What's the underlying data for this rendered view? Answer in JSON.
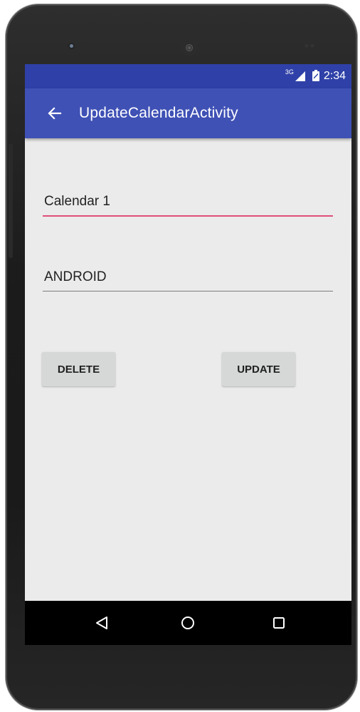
{
  "status_bar": {
    "network": "3G",
    "time": "2:34"
  },
  "toolbar": {
    "title": "UpdateCalendarActivity",
    "back_icon": "arrow-left-icon"
  },
  "form": {
    "calendar_name_value": "Calendar 1",
    "account_type_value": "ANDROID"
  },
  "buttons": {
    "delete_label": "DELETE",
    "update_label": "UPDATE"
  },
  "nav_bar": {
    "back_icon": "triangle-back-icon",
    "home_icon": "circle-home-icon",
    "recents_icon": "square-recents-icon"
  },
  "colors": {
    "status_bar": "#2f41a8",
    "toolbar": "#3f51b5",
    "accent_underline": "#e04e79",
    "screen_background": "#ebebeb",
    "button_background": "#d6d7d7"
  }
}
